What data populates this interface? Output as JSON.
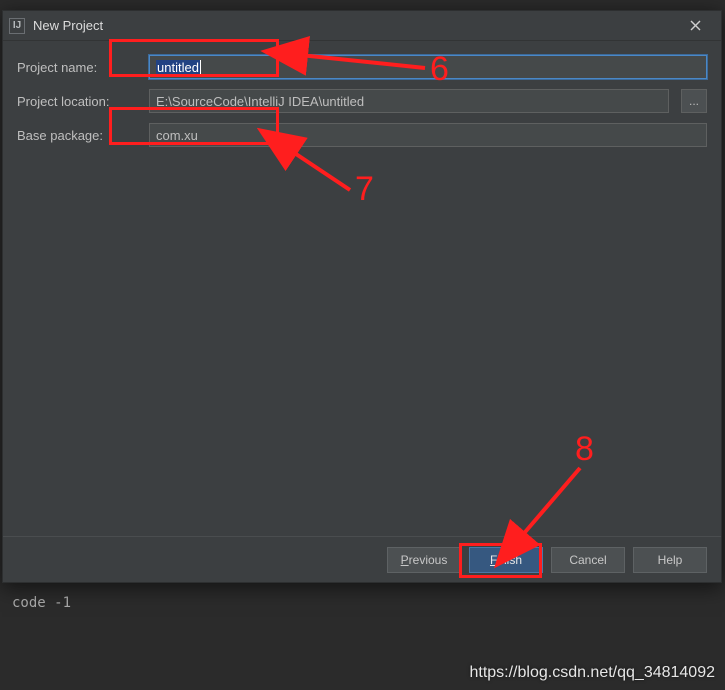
{
  "dialog": {
    "title": "New Project",
    "icon_label": "IJ"
  },
  "form": {
    "project_name": {
      "label": "Project name:",
      "value": "untitled"
    },
    "project_location": {
      "label": "Project location:",
      "value": "E:\\SourceCode\\IntelliJ IDEA\\untitled",
      "browse": "..."
    },
    "base_package": {
      "label": "Base package:",
      "value": "com.xu"
    }
  },
  "buttons": {
    "previous": "Previous",
    "finish": "Finish",
    "cancel": "Cancel",
    "help": "Help"
  },
  "terminal": {
    "line": "code -1"
  },
  "watermark": "https://blog.csdn.net/qq_34814092",
  "annotations": {
    "n6": "6",
    "n7": "7",
    "n8": "8"
  }
}
